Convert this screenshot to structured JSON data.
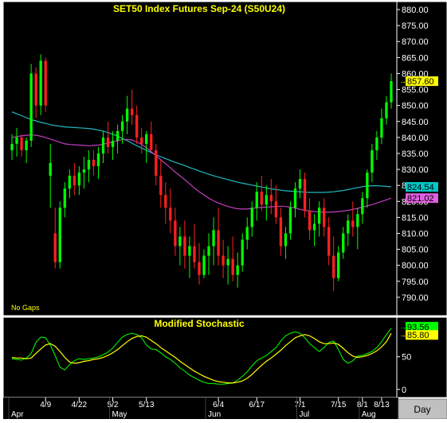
{
  "colors": {
    "background": "#000000",
    "frame": "#ffffff",
    "axis_panel": "#000000",
    "title_text": "#ffff00",
    "axis_text": "#ffffff",
    "bull_candle": "#00ff00",
    "bear_candle": "#ff2020",
    "ma_long": "#20b8c0",
    "ma_short": "#c040c0",
    "stoch_fast": "#00e000",
    "stoch_slow": "#ffff00",
    "last_price_bg": "#ffff00",
    "ma_long_badge_bg": "#00c8c8",
    "ma_short_badge_bg": "#e060e0",
    "stoch_fast_badge_bg": "#00ff00",
    "stoch_slow_badge_bg": "#ffff00",
    "gridline": "#404040",
    "day_button_bg": "#c0c0c0"
  },
  "chart_data": [
    {
      "type": "candlestick",
      "title": "SET50  Index  Futures  Sep-24  (S50U24)",
      "ylim": [
        785,
        882
      ],
      "y_ticks": [
        "790.00",
        "795.00",
        "800.00",
        "805.00",
        "810.00",
        "815.00",
        "820.00",
        "825.00",
        "830.00",
        "835.00",
        "840.00",
        "845.00",
        "850.00",
        "855.00",
        "860.00",
        "865.00",
        "870.00",
        "875.00",
        "880.00"
      ],
      "note": "No  Gaps",
      "last_price": "857.60",
      "ma_long_value": "824.54",
      "ma_short_value": "821.02",
      "candles": [
        [
          836,
          841,
          833,
          838
        ],
        [
          838,
          843,
          834,
          840
        ],
        [
          840,
          841,
          834,
          836
        ],
        [
          836,
          840,
          832,
          839
        ],
        [
          839,
          863,
          837,
          860
        ],
        [
          860,
          862,
          846,
          850
        ],
        [
          850,
          866,
          847,
          864
        ],
        [
          864,
          865,
          848,
          850
        ],
        [
          828,
          838,
          818,
          832
        ],
        [
          810,
          818,
          799,
          801
        ],
        [
          801,
          820,
          799,
          818
        ],
        [
          818,
          826,
          815,
          824
        ],
        [
          824,
          830,
          821,
          828
        ],
        [
          828,
          832,
          822,
          825
        ],
        [
          825,
          831,
          822,
          829
        ],
        [
          829,
          834,
          824,
          830
        ],
        [
          830,
          836,
          826,
          833
        ],
        [
          833,
          836,
          828,
          831
        ],
        [
          831,
          837,
          827,
          835
        ],
        [
          835,
          842,
          832,
          840
        ],
        [
          840,
          845,
          835,
          837
        ],
        [
          837,
          842,
          833,
          839
        ],
        [
          839,
          844,
          835,
          842
        ],
        [
          842,
          847,
          838,
          845
        ],
        [
          845,
          853,
          841,
          849
        ],
        [
          849,
          855,
          844,
          847
        ],
        [
          847,
          850,
          838,
          840
        ],
        [
          840,
          843,
          835,
          838
        ],
        [
          838,
          842,
          832,
          841
        ],
        [
          841,
          845,
          837,
          836
        ],
        [
          836,
          838,
          825,
          828
        ],
        [
          828,
          833,
          818,
          822
        ],
        [
          822,
          826,
          813,
          818
        ],
        [
          818,
          824,
          810,
          814
        ],
        [
          814,
          818,
          803,
          806
        ],
        [
          806,
          812,
          800,
          809
        ],
        [
          809,
          814,
          799,
          803
        ],
        [
          803,
          809,
          796,
          806
        ],
        [
          806,
          813,
          799,
          801
        ],
        [
          801,
          807,
          794,
          797
        ],
        [
          797,
          805,
          796,
          803
        ],
        [
          803,
          810,
          797,
          806
        ],
        [
          806,
          815,
          800,
          811
        ],
        [
          811,
          818,
          800,
          803
        ],
        [
          803,
          808,
          796,
          800
        ],
        [
          800,
          806,
          794,
          802
        ],
        [
          802,
          809,
          795,
          797
        ],
        [
          797,
          804,
          793,
          800
        ],
        [
          800,
          810,
          798,
          808
        ],
        [
          808,
          815,
          805,
          812
        ],
        [
          812,
          820,
          809,
          818
        ],
        [
          818,
          826,
          814,
          823
        ],
        [
          823,
          828,
          817,
          819
        ],
        [
          819,
          825,
          814,
          822
        ],
        [
          822,
          827,
          816,
          820
        ],
        [
          820,
          825,
          813,
          815
        ],
        [
          815,
          818,
          803,
          806
        ],
        [
          806,
          812,
          802,
          810
        ],
        [
          810,
          820,
          808,
          818
        ],
        [
          818,
          826,
          815,
          824
        ],
        [
          824,
          830,
          821,
          827
        ],
        [
          827,
          829,
          815,
          817
        ],
        [
          817,
          821,
          808,
          811
        ],
        [
          811,
          816,
          806,
          813
        ],
        [
          813,
          820,
          809,
          818
        ],
        [
          818,
          821,
          809,
          812
        ],
        [
          812,
          815,
          800,
          803
        ],
        [
          803,
          809,
          792,
          796
        ],
        [
          796,
          806,
          795,
          804
        ],
        [
          804,
          812,
          802,
          810
        ],
        [
          810,
          816,
          806,
          814
        ],
        [
          814,
          820,
          809,
          812
        ],
        [
          812,
          818,
          805,
          816
        ],
        [
          816,
          823,
          813,
          821
        ],
        [
          821,
          830,
          818,
          829
        ],
        [
          829,
          838,
          826,
          836
        ],
        [
          836,
          842,
          833,
          840
        ],
        [
          840,
          849,
          838,
          846
        ],
        [
          846,
          853,
          844,
          851
        ],
        [
          851,
          860,
          849,
          857.6
        ]
      ],
      "ma_long": [
        848,
        847.4,
        846.8,
        846.2,
        845.6,
        845.2,
        844.7,
        844.4,
        844,
        843.7,
        843.5,
        843.3,
        843.2,
        843.1,
        843,
        842.9,
        842.8,
        842.6,
        842.3,
        842,
        841.5,
        841,
        840.4,
        839.7,
        839,
        838.2,
        837.4,
        836.7,
        836,
        835.3,
        834.6,
        834,
        833.4,
        832.8,
        832.2,
        831.7,
        831.2,
        830.6,
        830.1,
        829.5,
        829,
        828.5,
        828,
        827.6,
        827.2,
        826.8,
        826.4,
        826,
        825.7,
        825.4,
        825.1,
        824.8,
        824.5,
        824.2,
        823.9,
        823.7,
        823.5,
        823.3,
        823.2,
        823.1,
        823,
        822.9,
        822.8,
        822.8,
        822.8,
        822.8,
        822.9,
        823,
        823.2,
        823.4,
        823.7,
        824,
        824.3,
        824.6,
        824.8,
        824.9,
        824.9,
        824.8,
        824.7,
        824.54
      ],
      "ma_short": [
        840,
        840.3,
        840.5,
        840.7,
        840.8,
        840.7,
        840.4,
        840,
        839.5,
        839,
        838.5,
        838,
        837.8,
        837.7,
        837.6,
        837.5,
        837.4,
        837.5,
        837.6,
        837.9,
        838.2,
        838.6,
        839,
        839.3,
        839.4,
        839.2,
        838.6,
        837.8,
        836.8,
        835.6,
        834.3,
        833,
        831.8,
        830.5,
        829.2,
        828,
        826.8,
        825.5,
        824.2,
        823,
        822,
        821,
        820.2,
        819.5,
        818.9,
        818.4,
        818,
        817.7,
        817.6,
        817.6,
        817.8,
        818,
        818.1,
        818.2,
        818.3,
        818.4,
        818.5,
        818.4,
        818.2,
        817.9,
        817.5,
        817.2,
        817,
        816.8,
        816.7,
        816.6,
        816.6,
        816.7,
        816.8,
        817,
        817.2,
        817.5,
        817.8,
        818.2,
        818.6,
        819,
        819.5,
        820,
        820.5,
        821.02
      ]
    },
    {
      "type": "line",
      "title": "Modified  Stochastic",
      "ylim": [
        -10,
        108
      ],
      "y_ticks": [
        "0",
        "50"
      ],
      "fast_value": "93.56",
      "slow_value": "85.80",
      "series": [
        {
          "values": [
            47,
            46,
            45,
            48,
            55,
            72,
            80,
            79,
            68,
            52,
            34,
            30,
            38,
            44,
            47,
            46,
            47,
            48,
            50,
            53,
            57,
            63,
            72,
            80,
            84,
            86,
            84,
            79,
            68,
            62,
            61,
            56,
            50,
            46,
            40,
            33,
            28,
            22,
            18,
            14,
            11,
            9,
            9,
            8,
            8,
            9,
            10,
            14,
            20,
            27,
            36,
            44,
            48,
            52,
            58,
            64,
            74,
            82,
            86,
            88,
            86,
            79,
            70,
            64,
            58,
            64,
            72,
            74,
            61,
            46,
            40,
            44,
            51,
            52,
            55,
            58,
            64,
            73,
            84,
            93.56
          ]
        },
        {
          "values": [
            49,
            48,
            48,
            47,
            48,
            55,
            62,
            68,
            70,
            66,
            58,
            49,
            42,
            40,
            41,
            43,
            44,
            46,
            47,
            49,
            52,
            56,
            61,
            67,
            73,
            78,
            81,
            82,
            80,
            75,
            70,
            64,
            59,
            54,
            49,
            43,
            38,
            33,
            28,
            24,
            20,
            17,
            14,
            12,
            11,
            10,
            10,
            11,
            13,
            17,
            23,
            30,
            37,
            43,
            48,
            54,
            60,
            67,
            73,
            79,
            82,
            84,
            82,
            78,
            73,
            70,
            70,
            71,
            69,
            63,
            56,
            51,
            49,
            50,
            52,
            55,
            59,
            65,
            73,
            85.8
          ]
        }
      ]
    }
  ],
  "x_axis": {
    "tick_labels": [
      "4/9",
      "4/22",
      "5/2",
      "5/13",
      "6/4",
      "6/17",
      "7/1",
      "7/15",
      "8/1",
      "8/13"
    ],
    "month_labels": [
      "Apr",
      "May",
      "Jun",
      "Jul",
      "Aug"
    ]
  },
  "buttons": {
    "day": "Day"
  }
}
